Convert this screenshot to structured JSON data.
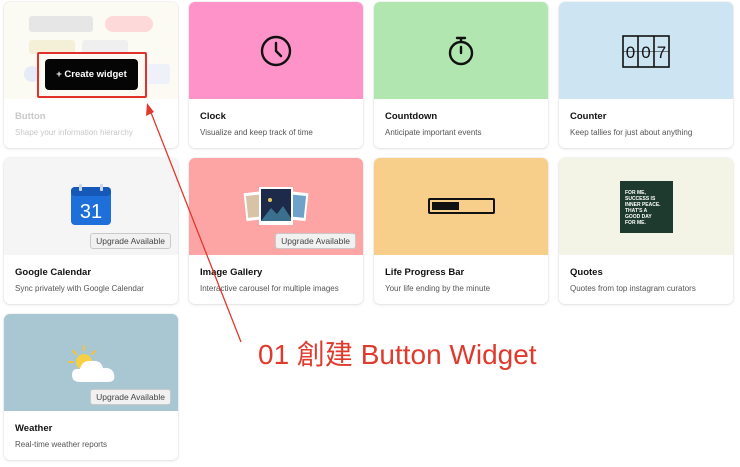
{
  "cards": [
    {
      "title": "Button",
      "desc": "Shape your information hierarchy"
    },
    {
      "title": "Clock",
      "desc": "Visualize and keep track of time",
      "bg": "#fd93c9"
    },
    {
      "title": "Countdown",
      "desc": "Anticipate important events",
      "bg": "#b1e6b0"
    },
    {
      "title": "Counter",
      "desc": "Keep tallies for just about anything",
      "bg": "#cde5f3"
    },
    {
      "title": "Google Calendar",
      "desc": "Sync privately with Google Calendar",
      "bg": "#f5f5f5",
      "badge": "Upgrade Available"
    },
    {
      "title": "Image Gallery",
      "desc": "Interactive carousel for multiple images",
      "bg": "#fda5a5",
      "badge": "Upgrade Available"
    },
    {
      "title": "Life Progress Bar",
      "desc": "Your life ending by the minute",
      "bg": "#f7cf8b"
    },
    {
      "title": "Quotes",
      "desc": "Quotes from top instagram curators",
      "bg": "#f4f4e6"
    },
    {
      "title": "Weather",
      "desc": "Real-time weather reports",
      "bg": "#a9c6d3",
      "badge": "Upgrade Available"
    }
  ],
  "create_button": "+ Create widget",
  "counter_digits": [
    "0",
    "0",
    "7"
  ],
  "calendar_day": "31",
  "quote_text": [
    "FOR ME,",
    "SUCCESS IS",
    "INNER PEACE.",
    "THAT'S A",
    "GOOD DAY",
    "FOR ME."
  ],
  "annotation": "01 創建 Button Widget",
  "colors": {
    "annotation": "#e03a2d",
    "create_button_bg": "#050505"
  },
  "icons": [
    "clock-icon",
    "stopwatch-icon",
    "counter-icon",
    "calendar-icon",
    "gallery-icon",
    "progress-bar-icon",
    "quote-image",
    "weather-icon"
  ]
}
